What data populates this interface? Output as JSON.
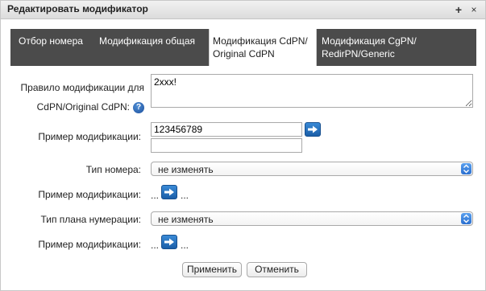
{
  "dialog": {
    "title": "Редактировать модификатор",
    "plus_icon": "+",
    "close_icon": "×"
  },
  "tabs": [
    {
      "label_line1": "Отбор номера",
      "label_line2": ""
    },
    {
      "label_line1": "Модификация общая",
      "label_line2": ""
    },
    {
      "label_line1": "Модификация CdPN/",
      "label_line2": "Original CdPN",
      "active": true
    },
    {
      "label_line1": "Модификация CgPN/",
      "label_line2": "RedirPN/Generic"
    }
  ],
  "form": {
    "rule_label_line1": "Правило модификации для",
    "rule_label_line2": "CdPN/Original CdPN:",
    "help_icon": "?",
    "rule_value": "2xxx!",
    "example1_label": "Пример модификации:",
    "example1_input": "123456789",
    "example1_result": "",
    "number_type_label": "Тип номера:",
    "number_type_value": "не изменять",
    "example2_label": "Пример модификации:",
    "example2_before": "...",
    "example2_after": "...",
    "numbering_plan_label": "Тип плана нумерации:",
    "numbering_plan_value": "не изменять",
    "example3_label": "Пример модификации:",
    "example3_before": "...",
    "example3_after": "..."
  },
  "buttons": {
    "apply": "Применить",
    "cancel": "Отменить"
  },
  "colors": {
    "tabbar": "#4b4b4b",
    "accent_blue": "#1a5ea8"
  }
}
